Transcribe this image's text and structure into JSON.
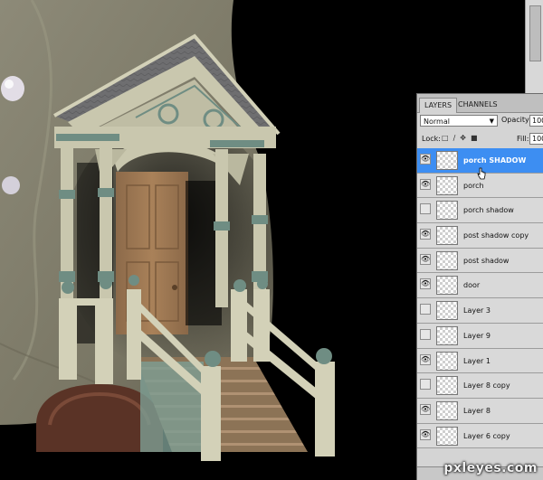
{
  "panel": {
    "tabs": [
      "LAYERS",
      "CHANNELS"
    ],
    "blend_mode": "Normal",
    "opacity_label": "Opacity:",
    "opacity_value": "100",
    "lock_label": "Lock:",
    "fill_label": "Fill:",
    "fill_value": "100"
  },
  "layers": [
    {
      "name": "porch SHADOW",
      "visible": true,
      "selected": true
    },
    {
      "name": "porch",
      "visible": true,
      "selected": false
    },
    {
      "name": "porch shadow",
      "visible": false,
      "selected": false
    },
    {
      "name": "post shadow copy",
      "visible": true,
      "selected": false
    },
    {
      "name": "post shadow",
      "visible": true,
      "selected": false
    },
    {
      "name": "door",
      "visible": true,
      "selected": false
    },
    {
      "name": "Layer 3",
      "visible": false,
      "selected": false
    },
    {
      "name": "Layer 9",
      "visible": false,
      "selected": false
    },
    {
      "name": "Layer 1",
      "visible": true,
      "selected": false
    },
    {
      "name": "Layer 8 copy",
      "visible": false,
      "selected": false
    },
    {
      "name": "Layer 8",
      "visible": true,
      "selected": false
    },
    {
      "name": "Layer 6 copy",
      "visible": true,
      "selected": false
    }
  ],
  "watermark": "pxleyes.com",
  "colors": {
    "panel_bg": "#d4d4d4",
    "selected_row": "#3d8ef2",
    "canvas_bg": "#000000",
    "wall": "#7e7b6a",
    "trim": "#c9c7ae",
    "teal_accent": "#6f8d83",
    "door": "#a07a55",
    "roof": "#6f6f70"
  },
  "icons": [
    "eye-icon",
    "lock-transparency-icon",
    "brush-lock-icon",
    "move-lock-icon",
    "lock-all-icon",
    "hand-cursor-icon"
  ]
}
